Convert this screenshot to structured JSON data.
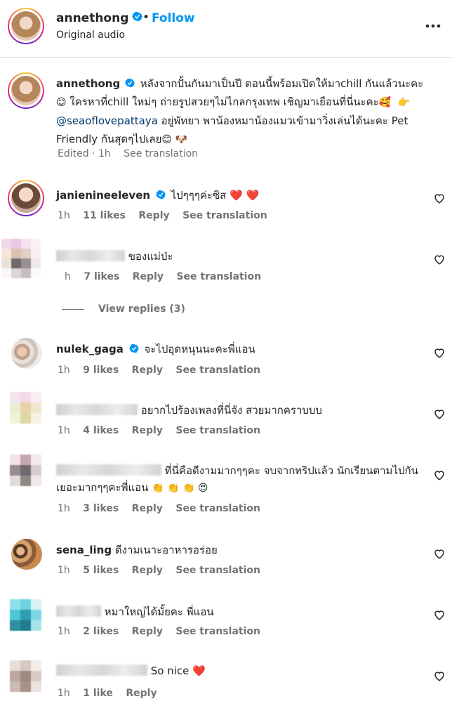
{
  "header": {
    "username": "annethong",
    "separator": "•",
    "follow_label": "Follow",
    "audio_label": "Original audio",
    "more_icon": "more-dots-icon"
  },
  "caption": {
    "username": "annethong",
    "text_1": "หลังจากปั้นกันมาเป็นปี ตอนนี้พร้อมเปิดให้มาchill กันแล้วนะคะ ",
    "emoji_1": "😊",
    "text_2": " ใครหาที่chill ใหม่ๆ ถ่ายรูปสวยๆไม่ไกลกรุงเทพ เชิญมาเยือนที่นี่นะคะ",
    "emoji_2": "🥰",
    "emoji_3": "👉",
    "mention": "@seaoflovepattaya",
    "text_3": " อยู่พัทยา พาน้องหมาน้องแมวเข้ามาวิ่งเล่นได้นะคะ Pet Friendly กันสุดๆไปเลย",
    "emoji_4": "😊",
    "emoji_5": "🐶",
    "meta_edited": "Edited · 1h",
    "meta_translation": "See translation"
  },
  "comments": [
    {
      "username": "janienineeleven",
      "verified": true,
      "text": "ไปๆๆๆค่ะซิส",
      "emoji": "❤️ ❤️",
      "time": "1h",
      "likes": "11 likes",
      "reply": "Reply",
      "translation": "See translation"
    },
    {
      "username": "",
      "text": "ของแม่ป่ะ",
      "time": "h",
      "likes": "7 likes",
      "reply": "Reply",
      "translation": "See translation"
    },
    {
      "username": "nulek_gaga",
      "verified": true,
      "text": "จะไปอุดหนุนนะคะพี่แอน",
      "time": "1h",
      "likes": "9 likes",
      "reply": "Reply",
      "translation": "See translation"
    },
    {
      "username": "",
      "text": "อยากไปร้องเพลงที่นี่จัง สวยมากคราบบบ",
      "time": "1h",
      "likes": "4 likes",
      "reply": "Reply",
      "translation": "See translation"
    },
    {
      "username": "",
      "text": "ที่นี่คือดีงามมากๆๆคะ จบจากทริปแล้ว นักเรียนตามไปกันเยอะมากๆๆคะพี่แอน",
      "emoji": "👏 👏 👏 😍",
      "time": "1h",
      "likes": "3 likes",
      "reply": "Reply",
      "translation": "See translation"
    },
    {
      "username": "sena_ling",
      "text": "ดีงามเนาะอาหารอร่อย",
      "time": "1h",
      "likes": "5 likes",
      "reply": "Reply",
      "translation": "See translation"
    },
    {
      "username": "",
      "text": "หมาใหญ่ได้มั้ยคะ พี่แอน",
      "time": "1h",
      "likes": "2 likes",
      "reply": "Reply",
      "translation": "See translation"
    },
    {
      "username": "",
      "text": "So nice",
      "emoji": "❤️",
      "time": "1h",
      "likes": "1 like",
      "reply": "Reply"
    }
  ],
  "view_replies": "View replies (3)",
  "colors": {
    "link_blue": "#0095f6",
    "mention_blue": "#00376b",
    "secondary_text": "#737373",
    "verified_blue": "#0095f6"
  }
}
